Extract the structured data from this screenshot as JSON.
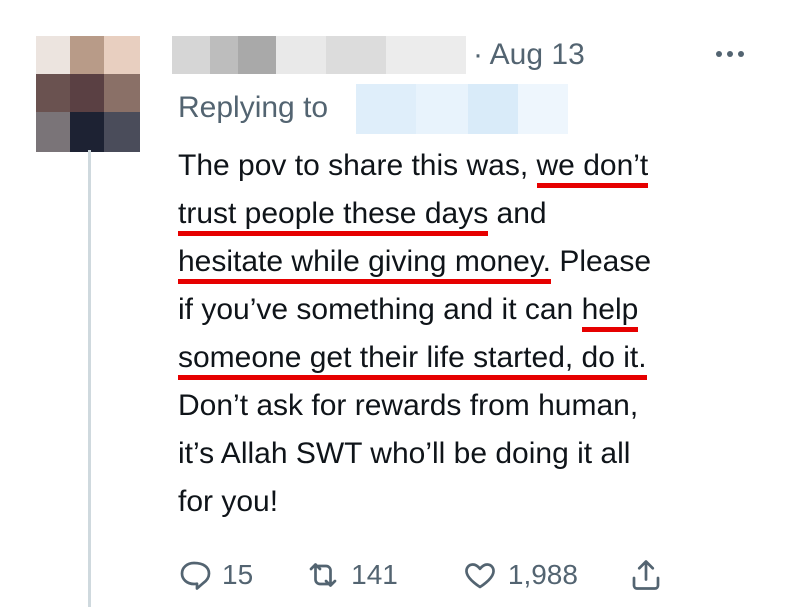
{
  "tweet": {
    "date": "· Aug 13",
    "replying_label": "Replying to",
    "body_lines": [
      [
        "The pov to share this was, ",
        "we don’t"
      ],
      [
        "trust people these days",
        " and"
      ],
      [
        "hesitate while giving money.",
        " Please"
      ],
      [
        "if you’ve something and it can ",
        "help"
      ],
      [
        "someone get their life started, do it.",
        ""
      ],
      [
        "Don’t ask for rewards from human,",
        ""
      ],
      [
        "it’s Allah SWT who’ll be doing it all",
        ""
      ],
      [
        "for you!",
        ""
      ]
    ]
  },
  "actions": {
    "reply": {
      "icon": "reply-icon",
      "count": "15"
    },
    "retweet": {
      "icon": "retweet-icon",
      "count": "141"
    },
    "like": {
      "icon": "heart-icon",
      "count": "1,988"
    },
    "share": {
      "icon": "share-icon"
    }
  },
  "colors": {
    "underline": "#e60000",
    "muted": "#536471",
    "thread": "#cfd9de"
  }
}
